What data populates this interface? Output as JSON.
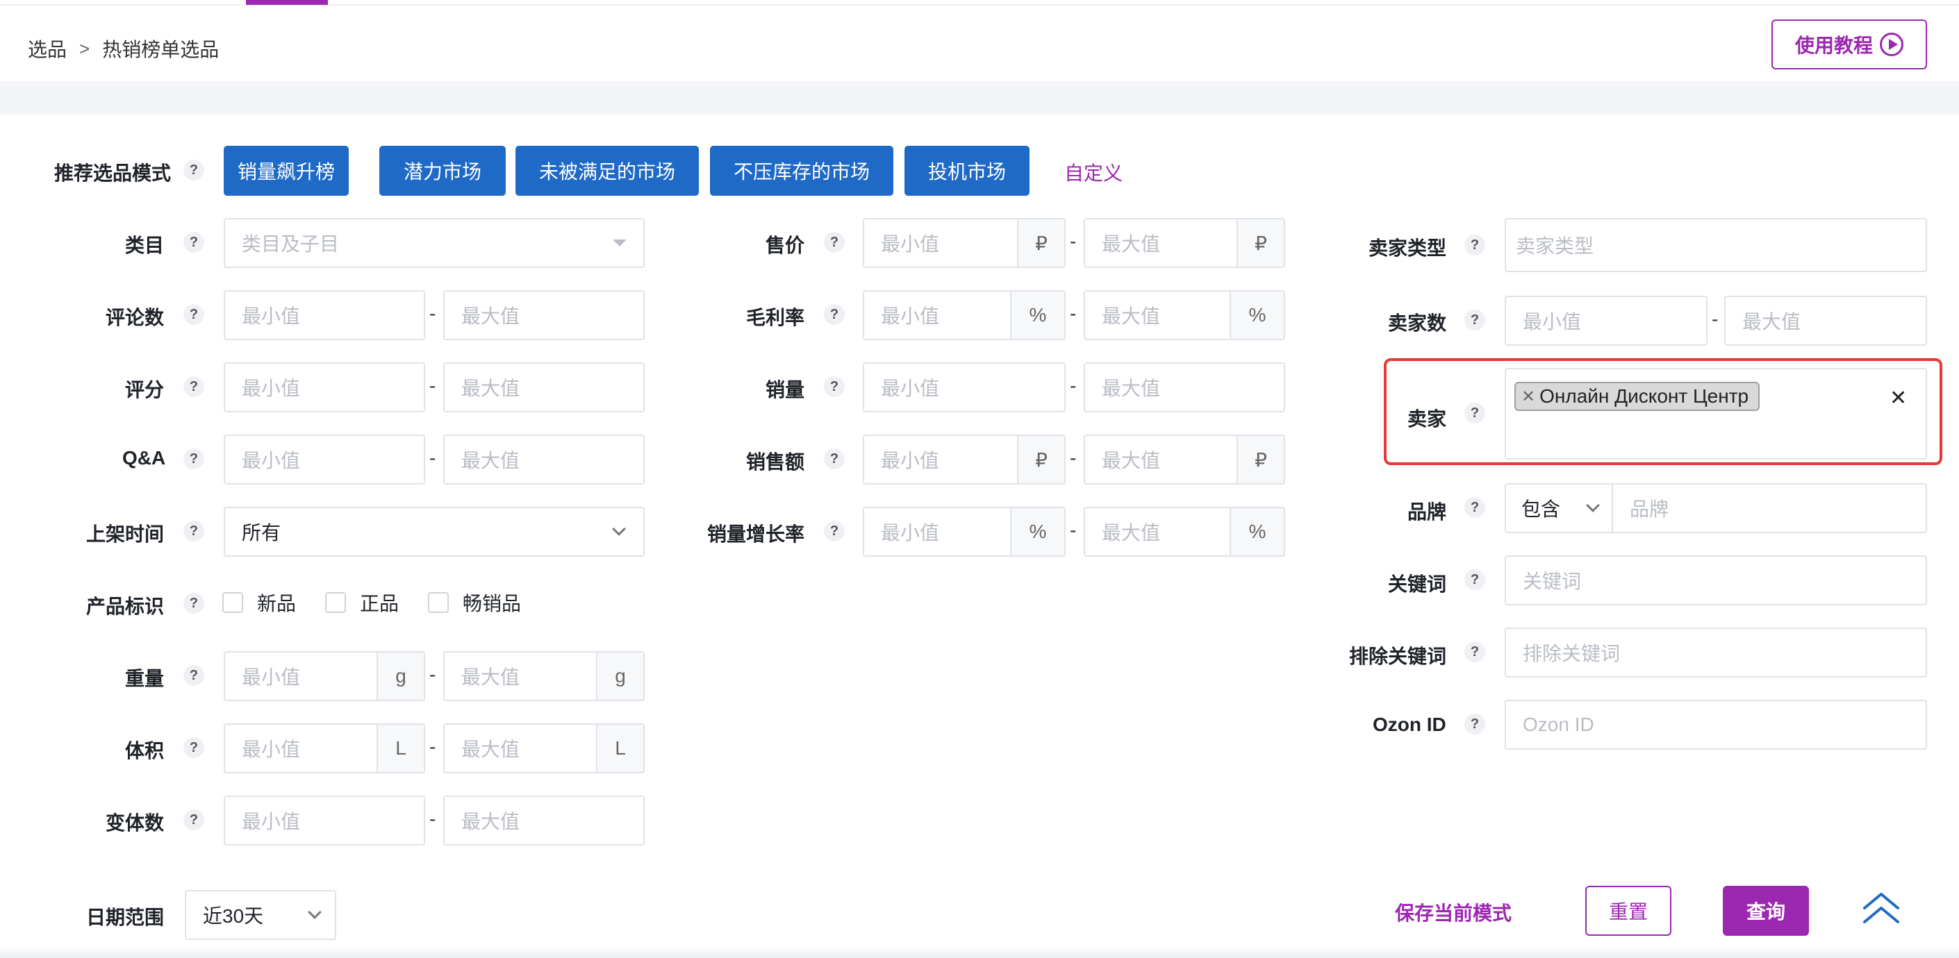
{
  "breadcrumb": {
    "root": "选品",
    "sep": ">",
    "current": "热销榜单选品"
  },
  "header": {
    "tutorial_label": "使用教程"
  },
  "mode": {
    "label": "推荐选品模式",
    "buttons": [
      "销量飙升榜",
      "潜力市场",
      "未被满足的市场",
      "不压库存的市场",
      "投机市场"
    ],
    "custom_link": "自定义"
  },
  "common": {
    "min": "最小值",
    "max": "最大值",
    "dash": "-",
    "help": "?"
  },
  "units": {
    "rub": "₽",
    "percent": "%",
    "gram": "g",
    "liter": "L"
  },
  "left": {
    "category_label": "类目",
    "category_placeholder": "类目及子目",
    "reviews_label": "评论数",
    "rating_label": "评分",
    "qa_label": "Q&A",
    "listed_label": "上架时间",
    "listed_value": "所有",
    "tags_label": "产品标识",
    "tags": [
      "新品",
      "正品",
      "畅销品"
    ],
    "weight_label": "重量",
    "volume_label": "体积",
    "variants_label": "变体数"
  },
  "middle": {
    "price_label": "售价",
    "margin_label": "毛利率",
    "sales_label": "销量",
    "revenue_label": "销售额",
    "growth_label": "销量增长率"
  },
  "right": {
    "seller_type_label": "卖家类型",
    "seller_type_placeholder": "卖家类型",
    "seller_count_label": "卖家数",
    "seller_label": "卖家",
    "seller_tag": "Онлайн Дисконт Центр",
    "brand_label": "品牌",
    "brand_mode": "包含",
    "brand_placeholder": "品牌",
    "keyword_label": "关键词",
    "keyword_placeholder": "关键词",
    "exclude_label": "排除关键词",
    "exclude_placeholder": "排除关键词",
    "ozon_label": "Ozon ID",
    "ozon_placeholder": "Ozon ID"
  },
  "footer": {
    "date_label": "日期范围",
    "date_value": "近30天",
    "save_label": "保存当前模式",
    "reset_label": "重置",
    "query_label": "查询"
  },
  "colors": {
    "primary_blue": "#1f6ac6",
    "accent_purple": "#9c27b0",
    "highlight_red": "#e53935"
  }
}
